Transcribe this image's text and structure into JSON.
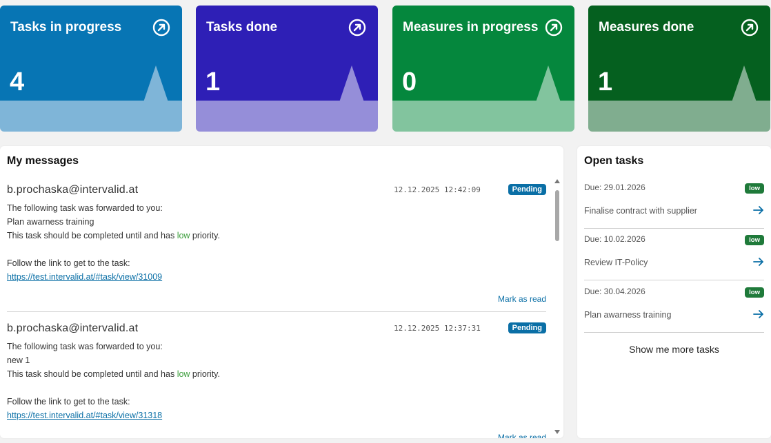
{
  "cards": [
    {
      "title": "Tasks in progress",
      "count": "4",
      "top_color": "#0775b4",
      "bottom_color": "#7fb5d8",
      "spike_color": "#7fb5d8"
    },
    {
      "title": "Tasks done",
      "count": "1",
      "top_color": "#2e1fb6",
      "bottom_color": "#958ed9",
      "spike_color": "#958ed9"
    },
    {
      "title": "Measures in progress",
      "count": "0",
      "top_color": "#05873d",
      "bottom_color": "#82c49e",
      "spike_color": "#82c49e"
    },
    {
      "title": "Measures done",
      "count": "1",
      "top_color": "#05601f",
      "bottom_color": "#80ad8f",
      "spike_color": "#80ad8f"
    }
  ],
  "messages": {
    "title": "My messages",
    "items": [
      {
        "sender": "b.prochaska@intervalid.at",
        "time": "12.12.2025 12:42:09",
        "status": "Pending",
        "line1": "The following task was forwarded to you:",
        "task": "Plan awarness training",
        "line3_pre": "This task should be completed until and has ",
        "priority": "low",
        "line3_post": " priority.",
        "line4": "Follow the link to get to the task:",
        "link": "https://test.intervalid.at/#task/view/31009",
        "action": "Mark as read"
      },
      {
        "sender": "b.prochaska@intervalid.at",
        "time": "12.12.2025 12:37:31",
        "status": "Pending",
        "line1": "The following task was forwarded to you:",
        "task": "new 1",
        "line3_pre": "This task should be completed until and has ",
        "priority": "low",
        "line3_post": " priority.",
        "line4": "Follow the link to get to the task:",
        "link": "https://test.intervalid.at/#task/view/31318",
        "action": "Mark as read"
      }
    ]
  },
  "tasks": {
    "title": "Open tasks",
    "items": [
      {
        "due": "Due: 29.01.2026",
        "priority": "low",
        "name": "Finalise contract with supplier"
      },
      {
        "due": "Due: 10.02.2026",
        "priority": "low",
        "name": "Review IT-Policy"
      },
      {
        "due": "Due: 30.04.2026",
        "priority": "low",
        "name": "Plan awarness training"
      }
    ],
    "more_label": "Show me more tasks"
  },
  "icons": {
    "card": "open-external-icon",
    "task": "arrow-right-icon"
  },
  "colors": {
    "link": "#0a6fa6",
    "priority_low": "#3d9e3d",
    "badge_low": "#1f7a3a"
  }
}
